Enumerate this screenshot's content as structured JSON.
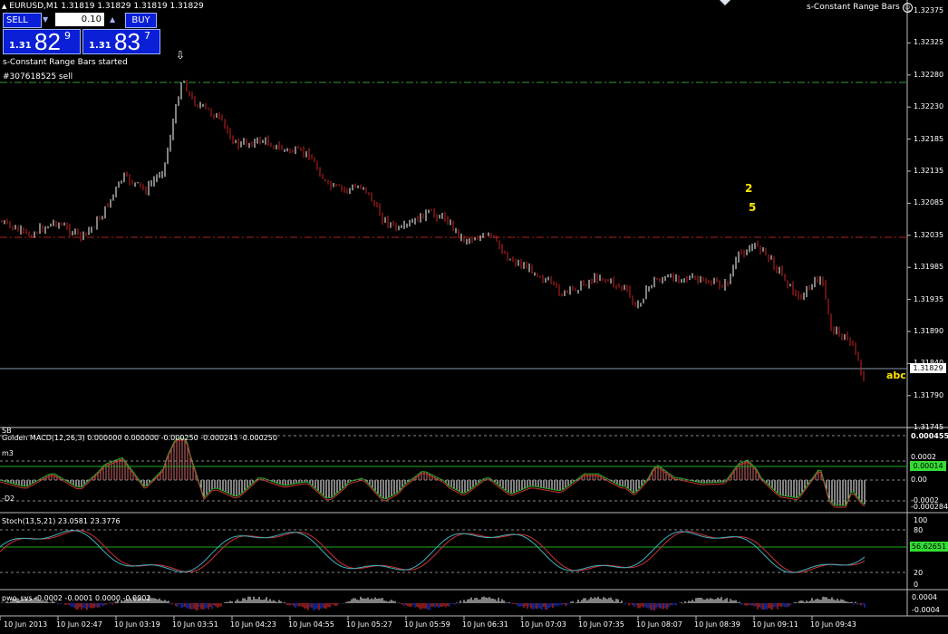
{
  "header": {
    "symbol_line": "EURUSD,M1  1.31819 1.31829 1.31819 1.31829",
    "indicator_name": "s-Constant Range Bars",
    "status_text": "s-Constant Range Bars started",
    "order_label": "#307618525 sell"
  },
  "trade_panel": {
    "sell_label": "SELL",
    "buy_label": "BUY",
    "lot_value": "0.10",
    "sell_prefix": "1.31",
    "sell_big": "82",
    "sell_sup": "9",
    "buy_prefix": "1.31",
    "buy_big": "83",
    "buy_sup": "7"
  },
  "annotations": {
    "wave_2": "2",
    "wave_5": "5",
    "abc": "abc",
    "arrow": "⇩"
  },
  "price_axis": {
    "labels": [
      "1.32375",
      "1.32325",
      "1.32280",
      "1.32230",
      "1.32185",
      "1.32135",
      "1.32085",
      "1.32035",
      "1.31985",
      "1.31935",
      "1.31890",
      "1.31840",
      "1.31790",
      "1.31745"
    ],
    "current": "1.31829"
  },
  "macd": {
    "title": "Golden MACD(12,26,3) 0.000000 0.000000 -0.000250 -0.000243 -0.000250",
    "label_m3": "m3",
    "label_d2": "-D2",
    "label_top": "SB",
    "axis": [
      "0.000455",
      "0.0002",
      "0.00",
      "-0.0002",
      "-0.000284"
    ],
    "current": "0.00014"
  },
  "stoch": {
    "title": "Stoch(13,5,21) 23.0581 23.3776",
    "axis": [
      "100",
      "80",
      "20",
      "0"
    ],
    "current": "56.62651"
  },
  "pwo": {
    "title": "pwo_svs -0.0002 -0.0001 0.0000 -0.0002",
    "axis": [
      "0.0004",
      "-0.0004"
    ]
  },
  "time_axis": [
    "10 Jun 2013",
    "10 Jun 02:47",
    "10 Jun 03:19",
    "10 Jun 03:51",
    "10 Jun 04:23",
    "10 Jun 04:55",
    "10 Jun 05:27",
    "10 Jun 05:59",
    "10 Jun 06:31",
    "10 Jun 07:03",
    "10 Jun 07:35",
    "10 Jun 08:07",
    "10 Jun 08:39",
    "10 Jun 09:11",
    "10 Jun 09:43"
  ],
  "colors": {
    "bear": "#cc2222",
    "bull": "#ffffff",
    "green_level": "#3a9a3a",
    "red_level": "#b02020",
    "stoch_main": "#3fb0c0",
    "stoch_signal": "#cc3333",
    "accent_yellow": "#ffe600",
    "panel_blue": "#0a1fd6"
  }
}
